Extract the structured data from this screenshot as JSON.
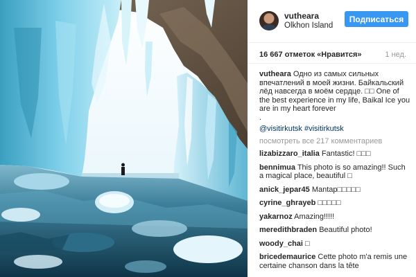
{
  "post": {
    "username": "vutheara",
    "location": "Olkhon Island",
    "follow_label": "Подписаться",
    "likes": "16 667 отметок «Нравится»",
    "time": "1 нед.",
    "caption": "Одно из самых сильных впечатлений в моей жизни. Байкальский лёд навсегда в моём сердце. □□ One of the best experience in my life, Baikal Ice you are in my heart forever\n.",
    "hashtags": [
      "@visitirkutsk",
      "#visitirkutsk"
    ],
    "view_all": "посмотреть все 217 комментариев"
  },
  "comments": [
    {
      "user": "lizabizzaro_italia",
      "text": "Fantastic! □□□"
    },
    {
      "user": "bennimua",
      "text": "This photo is so amazing!! Such a magical place, beautiful □"
    },
    {
      "user": "anick_jepar45",
      "text": "Mantap□□□□□"
    },
    {
      "user": "cyrine_ghrayeb",
      "text": "□□□□□"
    },
    {
      "user": "yakarnoz",
      "text": "Amazing!!!!!"
    },
    {
      "user": "meredithbraden",
      "text": "Beautiful photo!"
    },
    {
      "user": "woody_chai",
      "text": "□"
    },
    {
      "user": "bricedemaurice",
      "text": "Cette photo m'a remis une certaine chanson dans la tête"
    }
  ],
  "colors": {
    "follow_button": "#3897f0",
    "hashtag_link": "#003569",
    "muted_text": "#999999",
    "ice_light": "#bfe9f5",
    "ice_deep": "#1d6d8a",
    "rock": "#6b5a48"
  },
  "icons": {
    "avatar": "user-avatar"
  }
}
